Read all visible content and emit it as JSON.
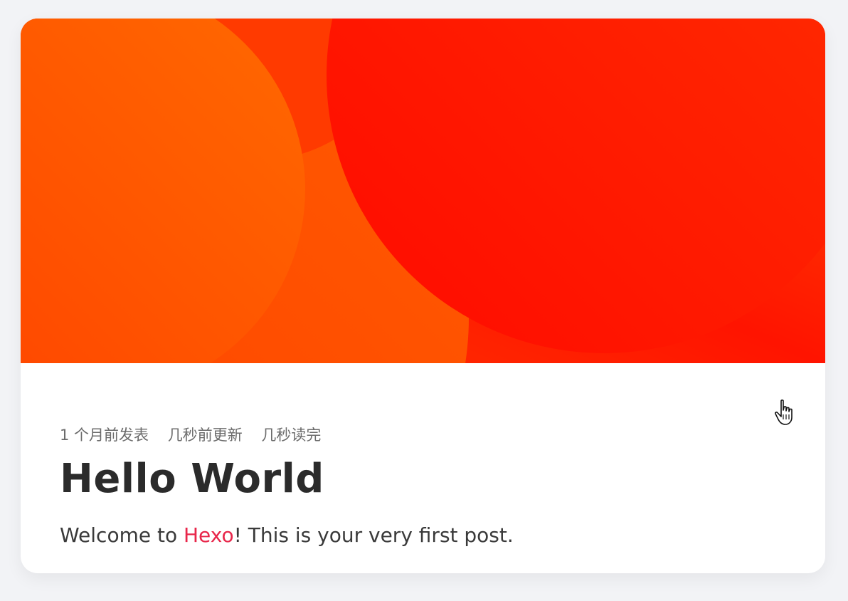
{
  "post": {
    "meta": {
      "published": "1 个月前发表",
      "updated": "几秒前更新",
      "read_time": "几秒读完"
    },
    "title": "Hello World",
    "excerpt": {
      "before": "Welcome to ",
      "link": "Hexo",
      "after": "! This is your very first post."
    }
  },
  "colors": {
    "page_bg": "#f2f3f6",
    "cover_orange": "#ff5a00",
    "cover_red": "#ff1a00",
    "link": "#e8264a",
    "title": "#2b2b2b"
  },
  "icons": {
    "cursor": "hand-pointer-icon"
  }
}
